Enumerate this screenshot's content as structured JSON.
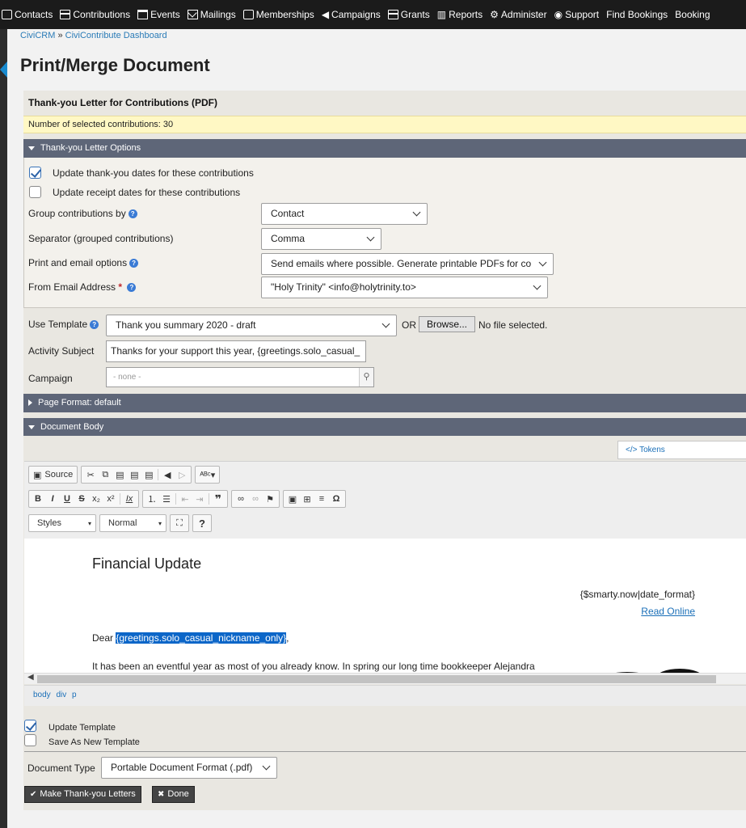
{
  "menu": {
    "items": [
      {
        "label": "Contacts",
        "icon": "contact-card-icon"
      },
      {
        "label": "Contributions",
        "icon": "credit-card-icon"
      },
      {
        "label": "Events",
        "icon": "calendar-icon"
      },
      {
        "label": "Mailings",
        "icon": "envelope-icon"
      },
      {
        "label": "Memberships",
        "icon": "id-badge-icon"
      },
      {
        "label": "Campaigns",
        "icon": "bullhorn-icon"
      },
      {
        "label": "Grants",
        "icon": "money-icon"
      },
      {
        "label": "Reports",
        "icon": "bar-chart-icon"
      },
      {
        "label": "Administer",
        "icon": "cogs-icon"
      },
      {
        "label": "Support",
        "icon": "life-ring-icon"
      },
      {
        "label": "Find Bookings",
        "icon": ""
      },
      {
        "label": "Booking",
        "icon": ""
      }
    ]
  },
  "breadcrumb": {
    "root": "CiviCRM",
    "sep": "»",
    "current": "CiviContribute Dashboard"
  },
  "page": {
    "title": "Print/Merge Document"
  },
  "form": {
    "heading": "Thank-you Letter for Contributions (PDF)",
    "selected_count_text": "Number of selected contributions: 30",
    "options_section": "Thank-you Letter Options",
    "update_thankyou_label": "Update thank-you dates for these contributions",
    "update_thankyou_checked": true,
    "update_receipt_label": "Update receipt dates for these contributions",
    "update_receipt_checked": false,
    "group_by_label": "Group contributions by",
    "group_by_value": "Contact",
    "separator_label": "Separator (grouped contributions)",
    "separator_value": "Comma",
    "print_email_label": "Print and email options",
    "print_email_value": "Send emails where possible. Generate printable PDFs for co",
    "from_email_label": "From Email Address",
    "from_email_required": "*",
    "from_email_value": "\"Holy Trinity\" <info@holytrinity.to>",
    "use_template_label": "Use Template",
    "use_template_value": "Thank you summary 2020 - draft",
    "or_text": "OR",
    "browse_label": "Browse...",
    "file_status": "No file selected.",
    "activity_subject_label": "Activity Subject",
    "activity_subject_value": "Thanks for your support this year, {greetings.solo_casual_",
    "campaign_label": "Campaign",
    "campaign_placeholder": "- none -",
    "page_format_section": "Page Format: default",
    "document_body_section": "Document Body",
    "tokens_label": "Tokens",
    "update_template_label": "Update Template",
    "update_template_checked": true,
    "save_new_template_label": "Save As New Template",
    "save_new_template_checked": false,
    "document_type_label": "Document Type",
    "document_type_value": "Portable Document Format (.pdf)",
    "make_letters_label": "Make Thank-you Letters",
    "done_label": "Done"
  },
  "editor": {
    "source_label": "Source",
    "styles_label": "Styles",
    "format_label": "Normal",
    "maximize_label": "⛶",
    "help_label": "?",
    "element_path": "body div p",
    "content": {
      "title": "Financial Update",
      "date_token": "{$smarty.now|date_format}",
      "read_online": "Read Online",
      "dear": "Dear",
      "greeting_token": "{greetings.solo_casual_nickname_only}",
      "greeting_suffix": ",",
      "paragraph": "It has been an eventful year as most of you already know. In spring our long time bookkeeper Alejandra"
    }
  },
  "colors": {
    "menubar": "#1b1b1b",
    "section_bar": "#5e6678",
    "status_bar": "#fff8c4",
    "link": "#1a6fb8",
    "selection": "#0c66c8"
  }
}
